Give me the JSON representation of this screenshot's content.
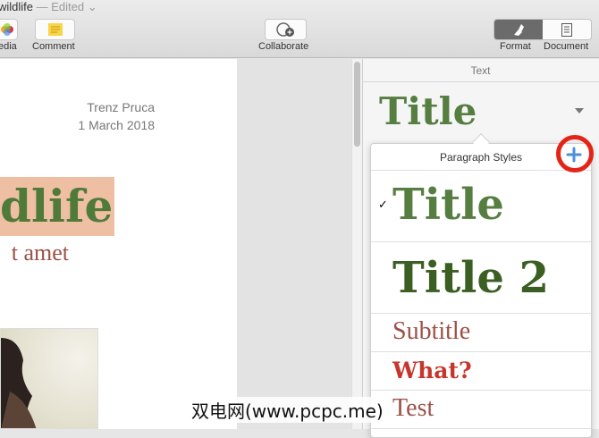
{
  "window": {
    "title": "wildlife",
    "status": "— Edited"
  },
  "toolbar": {
    "media": "edia",
    "comment": "Comment",
    "collaborate": "Collaborate",
    "format": "Format",
    "document": "Document"
  },
  "doc": {
    "author": "Trenz Pruca",
    "date": "1 March 2018",
    "title": "dlife",
    "subtitle": "t amet"
  },
  "sidebar": {
    "tab": "Text",
    "current_style": "Title"
  },
  "popover": {
    "header": "Paragraph Styles",
    "items": [
      "Title",
      "Title 2",
      "Subtitle",
      "What?",
      "Test"
    ],
    "checked": "✓"
  },
  "watermark": "双电网(www.pcpc.me)",
  "colors": {
    "title_green": "#567e41",
    "title2_green": "#3b5e22",
    "subtitle_red": "#9b5147",
    "what_red": "#c6362d",
    "highlight": "#e32416"
  }
}
